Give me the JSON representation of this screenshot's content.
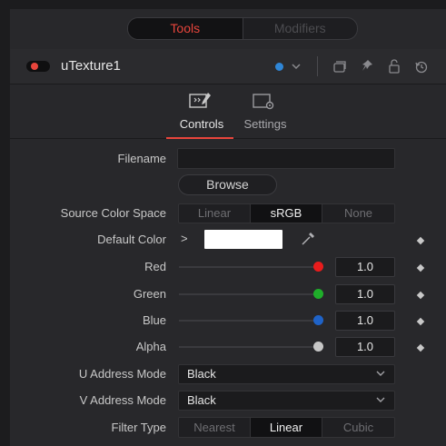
{
  "top_tabs": {
    "tools": "Tools",
    "modifiers": "Modifiers"
  },
  "node": {
    "name": "uTexture1"
  },
  "header_icons": [
    "color-dot-icon",
    "chevron-down-icon",
    "version-icon",
    "pin-icon",
    "lock-icon",
    "reset-icon"
  ],
  "sub_tabs": {
    "controls": "Controls",
    "settings": "Settings"
  },
  "fields": {
    "filename_label": "Filename",
    "filename_value": "",
    "browse_label": "Browse",
    "source_color_space_label": "Source Color Space",
    "source_color_space_options": [
      "Linear",
      "sRGB",
      "None"
    ],
    "source_color_space_selected": "sRGB",
    "default_color_label": "Default Color",
    "expand_glyph": ">"
  },
  "channels": [
    {
      "name": "Red",
      "value": "1.0",
      "color": "#e81c1c"
    },
    {
      "name": "Green",
      "value": "1.0",
      "color": "#1fae2a"
    },
    {
      "name": "Blue",
      "value": "1.0",
      "color": "#1f63c8"
    },
    {
      "name": "Alpha",
      "value": "1.0",
      "color": "#c6c6c6"
    }
  ],
  "address": {
    "u_label": "U Address Mode",
    "u_value": "Black",
    "v_label": "V Address Mode",
    "v_value": "Black"
  },
  "filter": {
    "label": "Filter Type",
    "options": [
      "Nearest",
      "Linear",
      "Cubic"
    ],
    "selected": "Linear"
  },
  "colors": {
    "accent": "#e8453c",
    "default_color_swatch": "#ffffff"
  }
}
